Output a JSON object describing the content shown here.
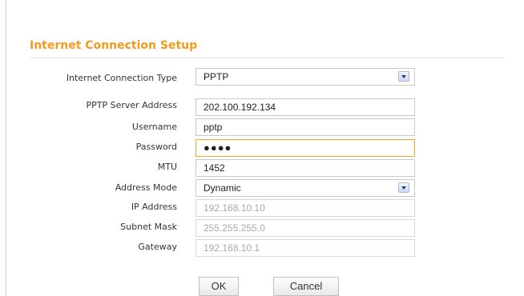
{
  "section": {
    "title": "Internet Connection Setup"
  },
  "connection_type": {
    "label": "Internet Connection Type",
    "value": "PPTP",
    "icon": "chevron-down-icon"
  },
  "fields": {
    "server_address": {
      "label": "PPTP Server Address",
      "value": "202.100.192.134"
    },
    "username": {
      "label": "Username",
      "value": "pptp"
    },
    "password": {
      "label": "Password",
      "value": "●●●●"
    },
    "mtu": {
      "label": "MTU",
      "value": "1452"
    },
    "address_mode": {
      "label": "Address Mode",
      "value": "Dynamic"
    },
    "ip_address": {
      "label": "IP Address",
      "value": "192.168.10.10"
    },
    "subnet_mask": {
      "label": "Subnet Mask",
      "value": "255.255.255.0"
    },
    "gateway": {
      "label": "Gateway",
      "value": "192.168.10.1"
    }
  },
  "buttons": {
    "ok": "OK",
    "cancel": "Cancel"
  },
  "colors": {
    "accent": "#f39a1e",
    "focus_border": "#f0a830",
    "disabled_text": "#a8a8a8"
  }
}
